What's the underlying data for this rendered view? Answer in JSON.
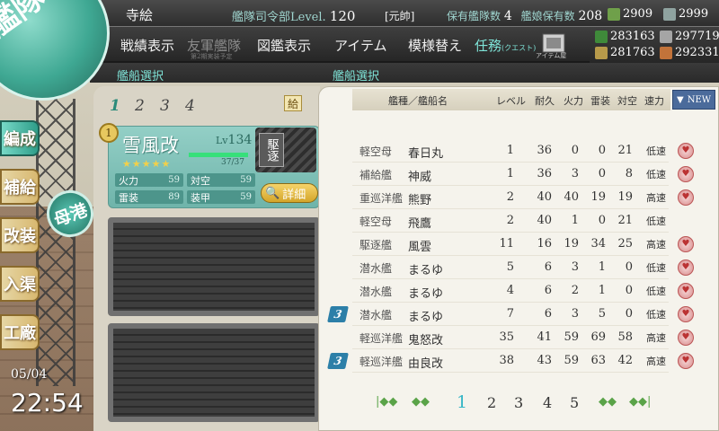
{
  "header": {
    "player_name": "寺絵",
    "hq_label": "艦隊司令部Level.",
    "hq_level": "120",
    "rank": "[元帥]",
    "ships_owned_label": "保有艦隊数",
    "ships_owned": "4",
    "girls_owned_label": "艦娘保有数",
    "girls_owned": "208",
    "buckets": "2909",
    "devmat": "2999",
    "fuel": "283163",
    "steel": "297719",
    "ammo": "281763",
    "bauxite": "292331"
  },
  "menu": {
    "items": [
      "戦績表示",
      "友軍艦隊",
      "図鑑表示",
      "アイテム",
      "模様替え",
      "任務"
    ],
    "quest_sub": "(クエスト)",
    "friend_sub": "第2期実装予定",
    "quest_icon_label": "アイテム屋"
  },
  "sections": {
    "left_title": "艦船選択",
    "right_title": "艦船選択"
  },
  "logo_text": "艦隊",
  "side_nav": [
    "編成",
    "補給",
    "改装",
    "入渠",
    "工廠"
  ],
  "port_label": "母港",
  "datetime": {
    "date": "05/04",
    "time": "22:54"
  },
  "fleet": {
    "tabs": [
      "1",
      "2",
      "3",
      "4"
    ],
    "supply_badge": "給",
    "slot_index": "1",
    "ship_name": "雪風改",
    "lv_label": "Lv",
    "level": "134",
    "stars": "★★★★★",
    "hp": "37/37",
    "hp_fraction": 1.0,
    "ship_type_stamp": "駆逐",
    "stats": [
      {
        "label": "火力",
        "value": "59"
      },
      {
        "label": "対空",
        "value": "59"
      },
      {
        "label": "雷装",
        "value": "89"
      },
      {
        "label": "装甲",
        "value": "59"
      }
    ],
    "detail_button": "詳細"
  },
  "list": {
    "headers": {
      "type_name": "艦種／艦船名",
      "level": "レベル",
      "hp": "耐久",
      "fire": "火力",
      "torpedo": "雷装",
      "aa": "対空",
      "speed": "速力"
    },
    "sort_button": "NEW",
    "rows": [
      {
        "type": "軽空母",
        "name": "春日丸",
        "level": "1",
        "hp": "36",
        "fire": "0",
        "torp": "0",
        "aa": "21",
        "speed": "低速",
        "heart": true,
        "fleet": ""
      },
      {
        "type": "補給艦",
        "name": "神威",
        "level": "1",
        "hp": "36",
        "fire": "3",
        "torp": "0",
        "aa": "8",
        "speed": "低速",
        "heart": true,
        "fleet": ""
      },
      {
        "type": "重巡洋艦",
        "name": "熊野",
        "level": "2",
        "hp": "40",
        "fire": "40",
        "torp": "19",
        "aa": "19",
        "speed": "高速",
        "heart": true,
        "fleet": ""
      },
      {
        "type": "軽空母",
        "name": "飛鷹",
        "level": "2",
        "hp": "40",
        "fire": "1",
        "torp": "0",
        "aa": "21",
        "speed": "低速",
        "heart": false,
        "fleet": ""
      },
      {
        "type": "駆逐艦",
        "name": "風雲",
        "level": "11",
        "hp": "16",
        "fire": "19",
        "torp": "34",
        "aa": "25",
        "speed": "高速",
        "heart": true,
        "fleet": ""
      },
      {
        "type": "潜水艦",
        "name": "まるゆ",
        "level": "5",
        "hp": "6",
        "fire": "3",
        "torp": "1",
        "aa": "0",
        "speed": "低速",
        "heart": true,
        "fleet": ""
      },
      {
        "type": "潜水艦",
        "name": "まるゆ",
        "level": "4",
        "hp": "6",
        "fire": "2",
        "torp": "1",
        "aa": "0",
        "speed": "低速",
        "heart": true,
        "fleet": ""
      },
      {
        "type": "潜水艦",
        "name": "まるゆ",
        "level": "7",
        "hp": "6",
        "fire": "3",
        "torp": "5",
        "aa": "0",
        "speed": "低速",
        "heart": true,
        "fleet": "3"
      },
      {
        "type": "軽巡洋艦",
        "name": "鬼怒改",
        "level": "35",
        "hp": "41",
        "fire": "59",
        "torp": "69",
        "aa": "58",
        "speed": "高速",
        "heart": true,
        "fleet": ""
      },
      {
        "type": "軽巡洋艦",
        "name": "由良改",
        "level": "38",
        "hp": "43",
        "fire": "59",
        "torp": "63",
        "aa": "42",
        "speed": "高速",
        "heart": true,
        "fleet": "3"
      }
    ],
    "pages": [
      "1",
      "2",
      "3",
      "4",
      "5"
    ],
    "current_page": "1"
  },
  "colors": {
    "accent": "#7fe4d8",
    "card": "#93cfc6",
    "panel": "#f5f3ec"
  }
}
